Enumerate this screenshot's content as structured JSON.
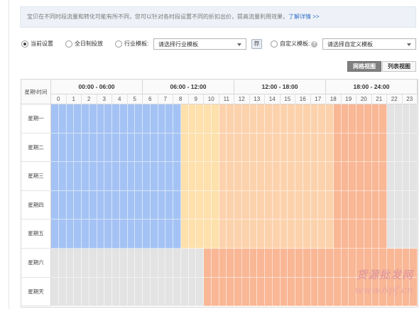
{
  "notice": {
    "text": "宝贝在不同时段流量和转化可能有所不同，您可以针对各时段设置不同的折扣出价，提高流量利用效果，",
    "link": "了解详情 >>"
  },
  "options": {
    "current": "当前设置",
    "all_day": "全日制投放",
    "industry": "行业模板:",
    "industry_select": "请选择行业模板",
    "apply_button": "荐",
    "custom": "自定义模板:",
    "help": "?",
    "custom_select": "请选择自定义模板"
  },
  "view": {
    "grid": "网格视图",
    "list": "列表视图"
  },
  "schedule": {
    "corner": "星期\\时间",
    "periods": [
      "00:00 - 06:00",
      "06:00 - 12:00",
      "12:00 - 18:00",
      "18:00 - 24:00"
    ],
    "hours": [
      "0",
      "1",
      "2",
      "3",
      "4",
      "5",
      "6",
      "7",
      "8",
      "9",
      "10",
      "11",
      "12",
      "13",
      "14",
      "15",
      "16",
      "17",
      "18",
      "19",
      "20",
      "21",
      "22",
      "23"
    ],
    "days": [
      "星期一",
      "星期二",
      "星期三",
      "星期四",
      "星期五",
      "星期六",
      "星期天"
    ]
  },
  "colors": {
    "blue": "#a4c2f4",
    "yellow": "#fde0ac",
    "peach": "#fcd2ad",
    "orange": "#f9b795",
    "empty": "#e3e3e3"
  },
  "cell_states": {
    "weekday": [
      {
        "from": 0,
        "to": 8.5,
        "color": "blue"
      },
      {
        "from": 8.5,
        "to": 11,
        "color": "yellow"
      },
      {
        "from": 11,
        "to": 18.5,
        "color": "peach"
      },
      {
        "from": 18.5,
        "to": 22,
        "color": "orange"
      },
      {
        "from": 22,
        "to": 24,
        "color": "empty"
      }
    ],
    "weekend": [
      {
        "from": 0,
        "to": 10,
        "color": "empty"
      },
      {
        "from": 10,
        "to": 24,
        "color": "orange"
      }
    ]
  },
  "watermark": {
    "line1": "货源批发网",
    "line2": "www.6pf.cn"
  }
}
